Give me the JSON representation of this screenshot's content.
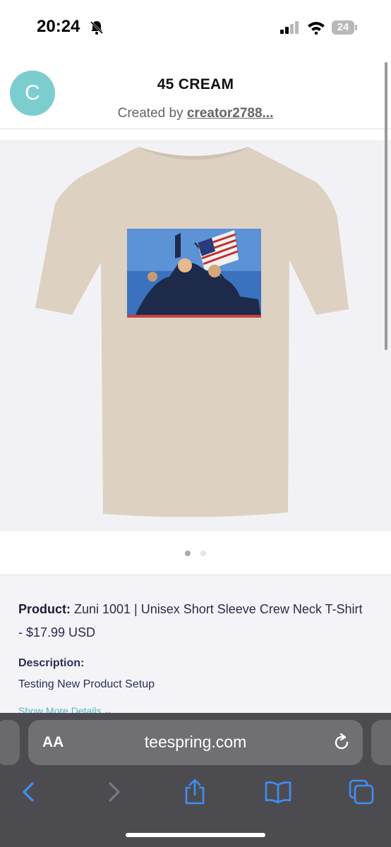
{
  "status_bar": {
    "time": "20:24",
    "battery": "24"
  },
  "header": {
    "avatar_letter": "C",
    "title": "45 CREAM",
    "created_by_prefix": "Created by ",
    "creator_name": "creator2788..."
  },
  "carousel": {
    "active_index": 0,
    "count": 2
  },
  "details": {
    "product_label": "Product:",
    "product_value": " Zuni 1001 | Unisex Short Sleeve Crew Neck T-Shirt - $17.99 USD",
    "description_label": "Description:",
    "description_value": "Testing New Product Setup",
    "show_more": "Show More Details ⌄"
  },
  "browser": {
    "aa_label": "AA",
    "url": "teespring.com"
  },
  "colors": {
    "accent": "#4fb8bd",
    "avatar": "#7bcdd0",
    "shirt": "#ddd1c2",
    "safari_blue": "#3f8ef7"
  }
}
